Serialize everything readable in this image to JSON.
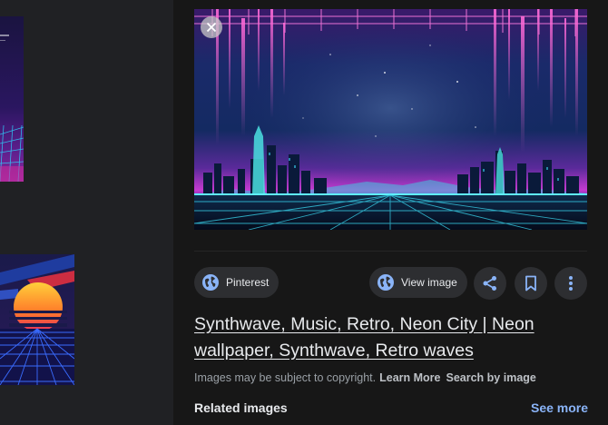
{
  "viewer": {
    "source_label": "Pinterest",
    "view_image_label": "View image",
    "title": "Synthwave, Music, Retro, Neon City | Neon wallpaper, Synthwave, Retro waves",
    "copyright_text": "Images may be subject to copyright.",
    "learn_more": "Learn More",
    "search_by_image": "Search by image",
    "related_heading": "Related images",
    "see_more": "See more"
  },
  "icons": {
    "close": "close-icon",
    "globe": "globe-icon",
    "share": "share-icon",
    "bookmark": "bookmark-icon",
    "more": "more-vert-icon"
  },
  "colors": {
    "accent_link": "#8ab4f8",
    "icon_blue": "#8ab4f8",
    "panel_bg": "#171717",
    "page_bg": "#202124"
  }
}
